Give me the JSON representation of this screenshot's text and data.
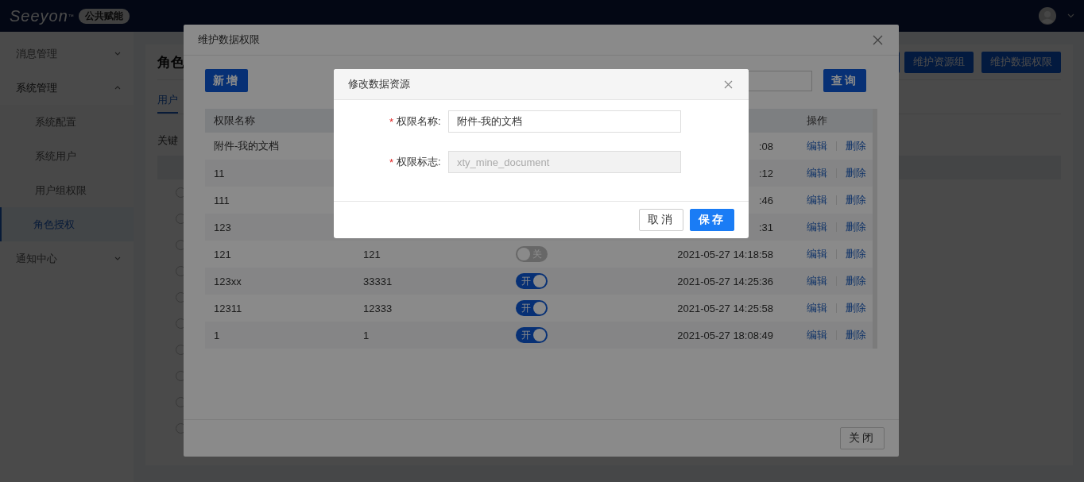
{
  "topbar": {
    "logo": "Seeyon",
    "logo_mark": "™",
    "badge": "公共赋能"
  },
  "sidebar": {
    "items": [
      {
        "label": "消息管理",
        "expanded": false
      },
      {
        "label": "系统管理",
        "expanded": true,
        "children": [
          {
            "label": "系统配置",
            "selected": false
          },
          {
            "label": "系统用户",
            "selected": false
          },
          {
            "label": "用户组权限",
            "selected": false
          },
          {
            "label": "角色授权",
            "selected": true
          }
        ]
      },
      {
        "label": "通知中心",
        "expanded": false
      }
    ]
  },
  "page": {
    "title": "角色",
    "toolbar_buttons": [
      "维护资源组",
      "维护数据权限"
    ],
    "tabs": [
      {
        "label": "用户",
        "selected": true
      }
    ],
    "filter_label": "关键",
    "radio_rows": [
      {
        "selected": false
      },
      {
        "selected": false
      },
      {
        "selected": false
      },
      {
        "selected": false
      },
      {
        "selected": false
      },
      {
        "selected": false
      },
      {
        "selected": false
      },
      {
        "selected": false
      },
      {
        "selected": false
      },
      {
        "selected": false
      }
    ]
  },
  "permissions_dialog": {
    "title": "维护数据权限",
    "add_button": "新增",
    "search_button": "查询",
    "header_name": "权限名称",
    "header_actions": "操作",
    "rows": [
      {
        "name": "附件-我的文档",
        "time": ":08",
        "actions": [
          "编辑",
          "删除"
        ]
      },
      {
        "name": "11",
        "time": ":12",
        "actions": [
          "编辑",
          "删除"
        ]
      },
      {
        "name": "111",
        "time": ":46",
        "actions": [
          "编辑",
          "删除"
        ]
      },
      {
        "name": "123",
        "time": ":31",
        "actions": [
          "编辑",
          "删除"
        ]
      },
      {
        "name": "121",
        "code": "121",
        "switch": {
          "on": false,
          "label": "关"
        },
        "time": "2021-05-27 14:18:58",
        "actions": [
          "编辑",
          "删除"
        ]
      },
      {
        "name": "123xx",
        "code": "33331",
        "switch": {
          "on": true,
          "label": "开"
        },
        "time": "2021-05-27 14:25:36",
        "actions": [
          "编辑",
          "删除"
        ]
      },
      {
        "name": "12311",
        "code": "12333",
        "switch": {
          "on": true,
          "label": "开"
        },
        "time": "2021-05-27 14:25:58",
        "actions": [
          "编辑",
          "删除"
        ]
      },
      {
        "name": "1",
        "code": "1",
        "switch": {
          "on": true,
          "label": "开"
        },
        "time": "2021-05-27 18:08:49",
        "actions": [
          "编辑",
          "删除"
        ]
      }
    ],
    "close_button": "关闭"
  },
  "edit_dialog": {
    "title": "修改数据资源",
    "fields": [
      {
        "mark": "*",
        "label": "权限名称:",
        "value": "附件-我的文档",
        "disabled": false
      },
      {
        "mark": "*",
        "label": "权限标志:",
        "value": "xty_mine_document",
        "disabled": true
      }
    ],
    "buttons": [
      {
        "label": "取消",
        "kind": "default"
      },
      {
        "label": "保存",
        "kind": "primary"
      }
    ]
  }
}
